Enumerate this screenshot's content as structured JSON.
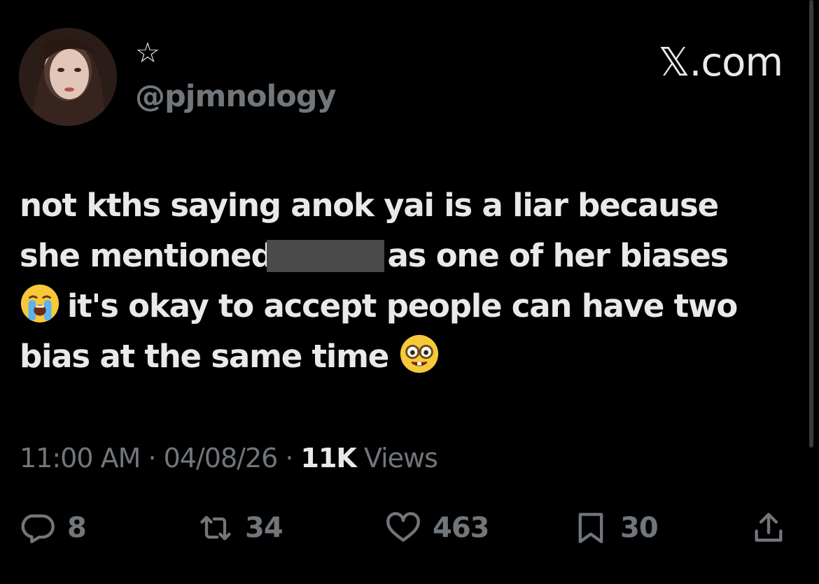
{
  "author": {
    "avatar_icon": "profile-photo",
    "badge_icon": "star-outline-icon",
    "handle": "@pjmnology"
  },
  "brand": {
    "label": "𝕏.com"
  },
  "tweet": {
    "lines": [
      "not kths saying anok yai is a liar because",
      "she mentioned",
      "as one of her biases",
      "it's okay to accept people can have two",
      "bias at the same time"
    ],
    "emojis": [
      "loudly-crying-face-emoji",
      "nerd-face-emoji"
    ]
  },
  "meta": {
    "time": "11:00 AM",
    "separator": " · ",
    "date": "04/08/26",
    "views_count": "11K",
    "views_label": " Views"
  },
  "actions": {
    "replies": "8",
    "reposts": "34",
    "likes": "463",
    "bookmarks": "30"
  },
  "colors": {
    "background": "#000000",
    "text": "#e7e9ea",
    "muted": "#71767b",
    "redaction": "#4a4a4a"
  }
}
